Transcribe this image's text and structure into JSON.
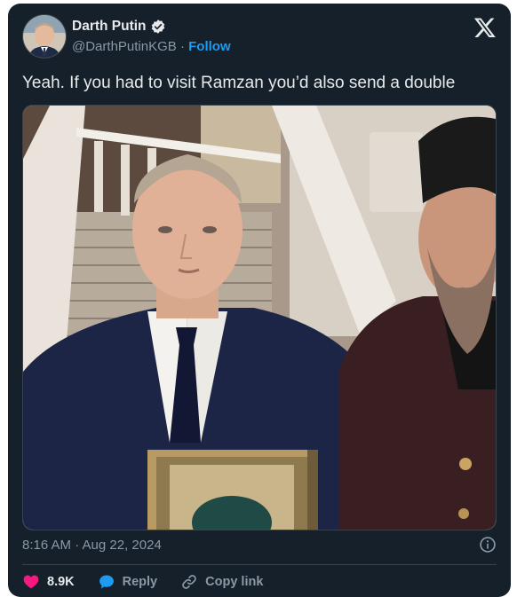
{
  "user": {
    "display_name": "Darth Putin",
    "handle": "@DarthPutinKGB",
    "separator": "·",
    "follow_label": "Follow"
  },
  "tweet": {
    "text": "Yeah. If you had to visit Ramzan you’d also send a double",
    "timestamp": "8:16 AM · Aug 22, 2024"
  },
  "actions": {
    "like_count": "8.9K",
    "reply_label": "Reply",
    "copy_link_label": "Copy link"
  },
  "colors": {
    "background": "#15202b",
    "text": "#e7e9ea",
    "muted": "#8b98a5",
    "accent": "#1d9bf0",
    "like": "#f91880"
  },
  "icons": {
    "verified": "verified-badge-icon",
    "logo": "x-logo-icon",
    "info": "info-icon",
    "like": "heart-icon",
    "reply": "speech-bubble-icon",
    "copy_link": "link-icon"
  }
}
